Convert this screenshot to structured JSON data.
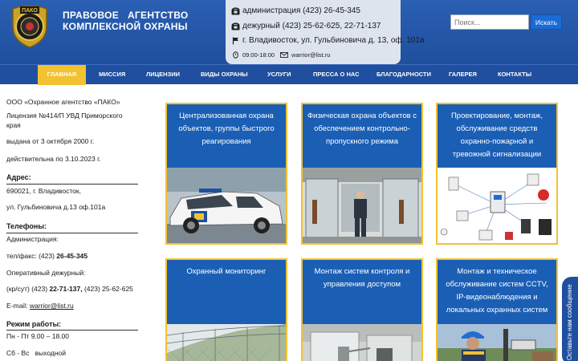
{
  "brand": {
    "logo_text": "ПАКО",
    "line1": "ПРАВОВОЕ   АГЕНТСТВО",
    "line2": "КОМПЛЕКСНОЙ ОХРАНЫ"
  },
  "contacts": {
    "admin": "администрация (423) 26-45-345",
    "duty": "дежурный (423) 25-62-625, 22-71-137",
    "address": "г. Владивосток, ул. Гульбиновича д. 13, оф. 101а",
    "hours": "09:00-18:00",
    "email": "warrior@list.ru"
  },
  "search": {
    "placeholder": "Поиск...",
    "button": "Искать"
  },
  "nav": {
    "items": [
      "Главная",
      "Миссия",
      "Лицензии",
      "Виды охраны",
      "Услуги",
      "Пресса о нас",
      "Благодарности",
      "Галерея",
      "Контакты"
    ],
    "active_index": 0
  },
  "info": {
    "company": "ООО «Охранное агентство «ПАКО»",
    "license1": "Лицензия №414/П УВД Приморского",
    "license2": "края",
    "issued": "выдана от 3 октября 2000 г.",
    "valid": "действительна по 3.10.2023 г.",
    "address_h": "Адрес:",
    "address1": "690021, г. Владивосток,",
    "address2": "ул. Гульбиновича д.13 оф.101а",
    "phones_h": "Телефоны:",
    "admin_label": "Администрация:",
    "fax_label": "тел/факс:  (423)",
    "fax_number": "26-45-345",
    "duty_label": "Оперативный дежурный:",
    "duty_prefix": "(кр/сут) (423)",
    "duty_number": "22-71-137,",
    "duty_rest": "(423) 25-62-625",
    "email_label": "E-mail:",
    "email": "warrior@list.ru",
    "hours_h": "Режим работы:",
    "hours1": "Пн - Пт  9.00 – 18.00",
    "hours2": "Сб - Вс   выходной"
  },
  "cards": [
    {
      "title": "Централизованная охрана объектов, группы быстрого реагирования",
      "image": "security-car-photo"
    },
    {
      "title": "Физическая охрана объектов с обеспечением контрольно-пропускного режима",
      "image": "guard-at-entrance-photo"
    },
    {
      "title": "Проектирование, монтаж, обслуживание средств охранно-пожарной и тревожной сигнализации",
      "image": "alarm-equipment-diagram"
    },
    {
      "title": "Охранный мониторинг",
      "image": "fence-cctv-photo"
    },
    {
      "title": "Монтаж систем контроля и управления доступом",
      "image": "turnstile-photo"
    },
    {
      "title": "Монтаж и техническое обслуживание систем CCTV, IP-видеонаблюдения и локальных охранных систем",
      "image": "technician-photo"
    }
  ],
  "side_tab": "Оставьте нам сообщение",
  "colors": {
    "header_blue": "#1f4f9e",
    "accent_yellow": "#f2c230",
    "card_blue": "#1b5fb5",
    "button_blue": "#1b6bd6"
  }
}
